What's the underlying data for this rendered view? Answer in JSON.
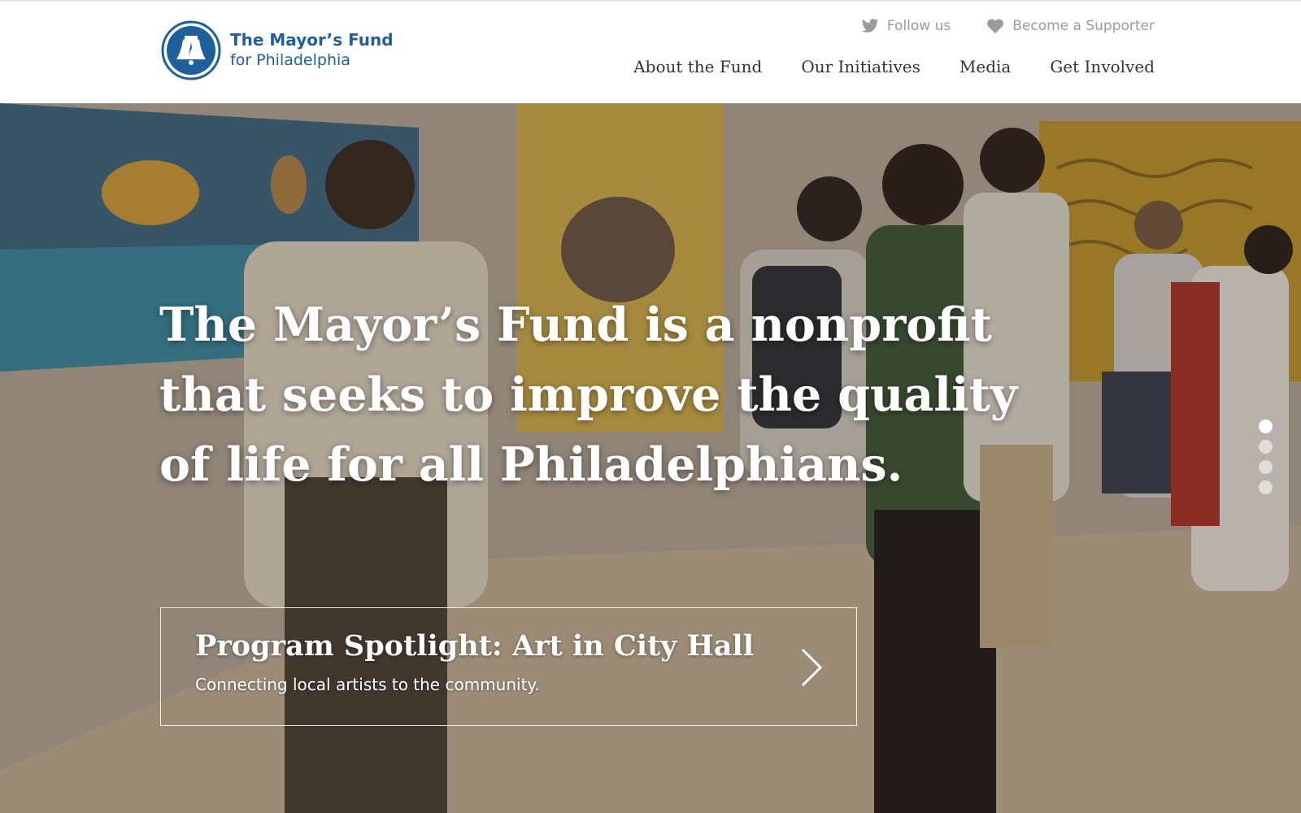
{
  "header": {
    "logo": {
      "line1": "The Mayor’s Fund",
      "line2": "for Philadelphia",
      "icon": "liberty-bell-icon"
    },
    "utility_links": [
      {
        "label": "Follow us",
        "icon": "twitter-icon"
      },
      {
        "label": "Become a Supporter",
        "icon": "heart-icon"
      }
    ],
    "nav": [
      {
        "label": "About the Fund"
      },
      {
        "label": "Our Initiatives"
      },
      {
        "label": "Media"
      },
      {
        "label": "Get Involved"
      }
    ]
  },
  "hero": {
    "headline": "The Mayor’s Fund is a nonprofit that seeks to improve the quality of life for all Philadelphians.",
    "spotlight": {
      "title": "Program Spotlight: Art in City Hall",
      "subtitle": "Connecting local artists to the community."
    },
    "slides": {
      "count": 4,
      "active": 1
    }
  },
  "colors": {
    "brand_blue": "#1e5f9e",
    "utility_gray": "#9b9b9b",
    "nav_text": "#333333"
  }
}
